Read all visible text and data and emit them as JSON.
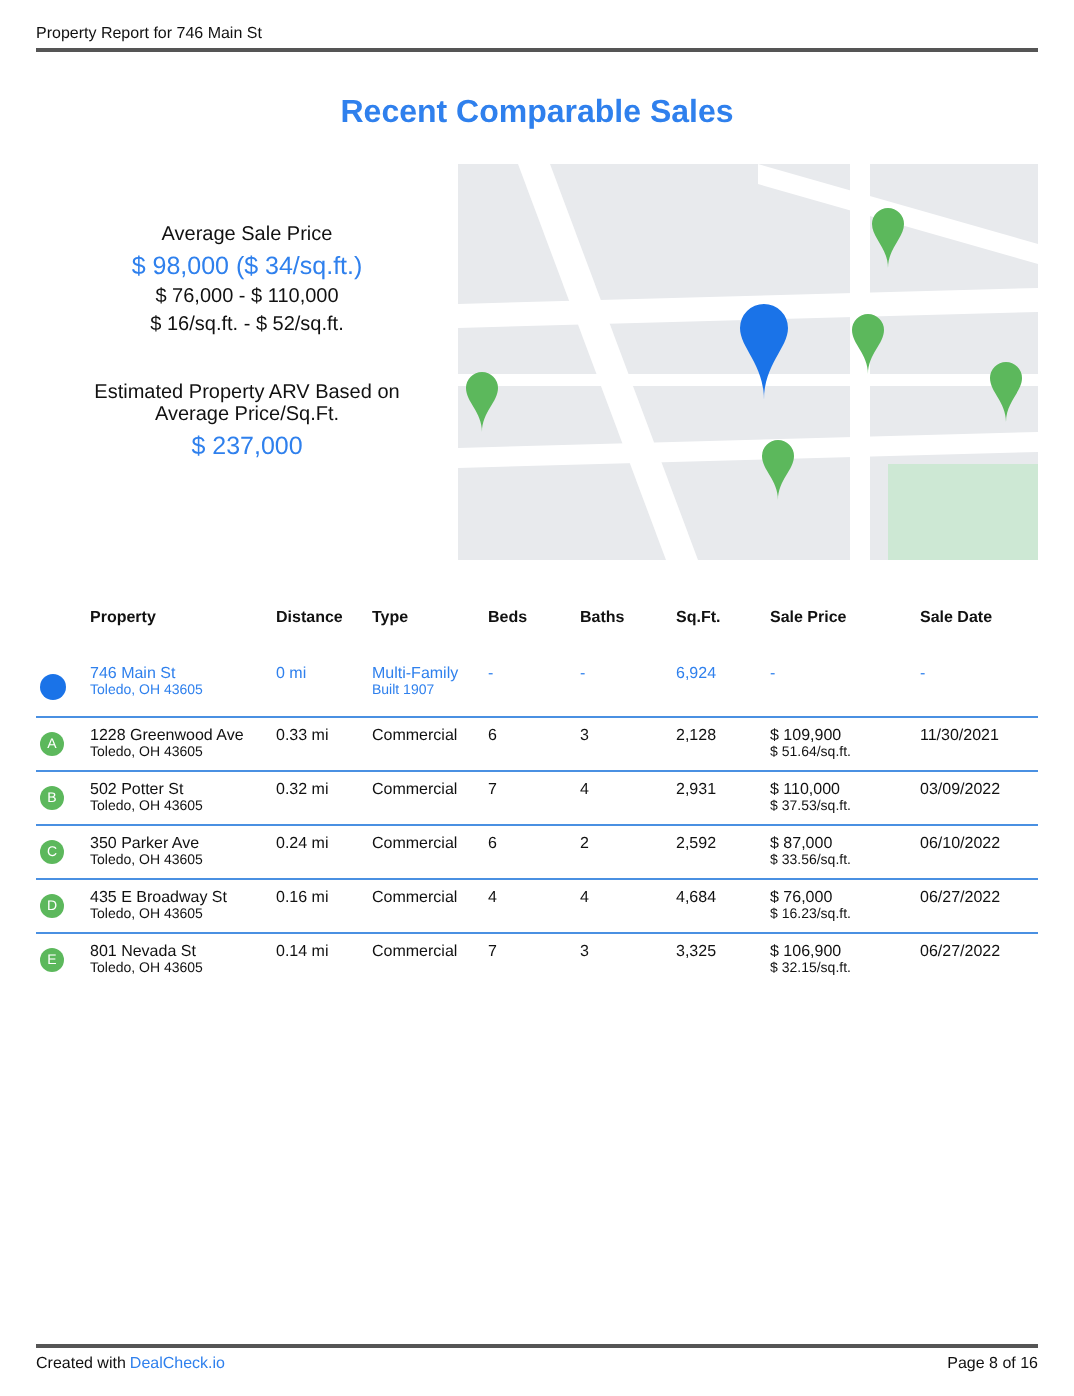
{
  "header": {
    "title": "Property Report for 746 Main St"
  },
  "heading": "Recent Comparable Sales",
  "summary": {
    "avg_label": "Average Sale Price",
    "avg_value": "$ 98,000 ($ 34/sq.ft.)",
    "price_range": "$ 76,000  -  $ 110,000",
    "sqft_range": "$ 16/sq.ft.  -  $ 52/sq.ft.",
    "arv_label": "Estimated Property ARV Based on Average Price/Sq.Ft.",
    "arv_value": "$ 237,000"
  },
  "table": {
    "columns": [
      "Property",
      "Distance",
      "Type",
      "Beds",
      "Baths",
      "Sq.Ft.",
      "Sale Price",
      "Sale Date"
    ],
    "rows": [
      {
        "kind": "subject",
        "marker": "",
        "address": "746 Main St",
        "city": "Toledo, OH 43605",
        "distance": "0 mi",
        "type": "Multi-Family",
        "type_note": "Built 1907",
        "beds": "-",
        "baths": "-",
        "sqft": "6,924",
        "price": "-",
        "price_per_sqft": "",
        "date": "-"
      },
      {
        "kind": "comp",
        "marker": "A",
        "address": "1228 Greenwood Ave",
        "city": "Toledo, OH 43605",
        "distance": "0.33 mi",
        "type": "Commercial",
        "type_note": "",
        "beds": "6",
        "baths": "3",
        "sqft": "2,128",
        "price": "$ 109,900",
        "price_per_sqft": "$ 51.64/sq.ft.",
        "date": "11/30/2021"
      },
      {
        "kind": "comp",
        "marker": "B",
        "address": "502 Potter St",
        "city": "Toledo, OH 43605",
        "distance": "0.32 mi",
        "type": "Commercial",
        "type_note": "",
        "beds": "7",
        "baths": "4",
        "sqft": "2,931",
        "price": "$ 110,000",
        "price_per_sqft": "$ 37.53/sq.ft.",
        "date": "03/09/2022"
      },
      {
        "kind": "comp",
        "marker": "C",
        "address": "350 Parker Ave",
        "city": "Toledo, OH 43605",
        "distance": "0.24 mi",
        "type": "Commercial",
        "type_note": "",
        "beds": "6",
        "baths": "2",
        "sqft": "2,592",
        "price": "$ 87,000",
        "price_per_sqft": "$ 33.56/sq.ft.",
        "date": "06/10/2022"
      },
      {
        "kind": "comp",
        "marker": "D",
        "address": "435 E Broadway St",
        "city": "Toledo, OH 43605",
        "distance": "0.16 mi",
        "type": "Commercial",
        "type_note": "",
        "beds": "4",
        "baths": "4",
        "sqft": "4,684",
        "price": "$ 76,000",
        "price_per_sqft": "$ 16.23/sq.ft.",
        "date": "06/27/2022"
      },
      {
        "kind": "comp",
        "marker": "E",
        "address": "801 Nevada St",
        "city": "Toledo, OH 43605",
        "distance": "0.14 mi",
        "type": "Commercial",
        "type_note": "",
        "beds": "7",
        "baths": "3",
        "sqft": "3,325",
        "price": "$ 106,900",
        "price_per_sqft": "$ 32.15/sq.ft.",
        "date": "06/27/2022"
      }
    ]
  },
  "footer": {
    "credit_text": "Created with",
    "credit_link": "DealCheck.io",
    "page": "Page 8 of 16"
  }
}
